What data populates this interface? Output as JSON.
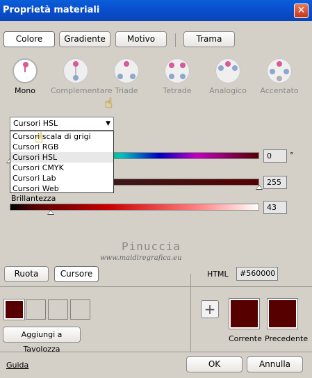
{
  "window": {
    "title": "Proprietà materiali",
    "close": "✕"
  },
  "tabs": [
    "Colore",
    "Gradiente",
    "Motivo",
    "Trama"
  ],
  "harmonies": [
    "Mono",
    "Complementare",
    "Triade",
    "Tetrade",
    "Analogico",
    "Accentato"
  ],
  "combo": {
    "value": "Cursori HSL"
  },
  "dropdown": [
    "Cursori scala di grigi",
    "Cursori RGB",
    "Cursori HSL",
    "Cursori CMYK",
    "Cursori Lab",
    "Cursori Web"
  ],
  "sliders": {
    "hue": {
      "value": "0",
      "unit": "°"
    },
    "saturation": {
      "value": "255"
    },
    "brightness": {
      "label": "Brillantezza",
      "value": "43"
    }
  },
  "watermark": {
    "name": "Pinuccia",
    "site": "www.maidiregrafica.eu"
  },
  "mode_buttons": {
    "wheel": "Ruota",
    "slider": "Cursore"
  },
  "html": {
    "label": "HTML",
    "value": "#560000"
  },
  "palette": {
    "add_label": "Aggiungi a Tavolozza",
    "plus": "+"
  },
  "current": {
    "label": "Corrente",
    "color": "#560000"
  },
  "previous": {
    "label": "Precedente",
    "color": "#560000"
  },
  "footer": {
    "help": "Guida",
    "ok": "OK",
    "cancel": "Annulla"
  }
}
